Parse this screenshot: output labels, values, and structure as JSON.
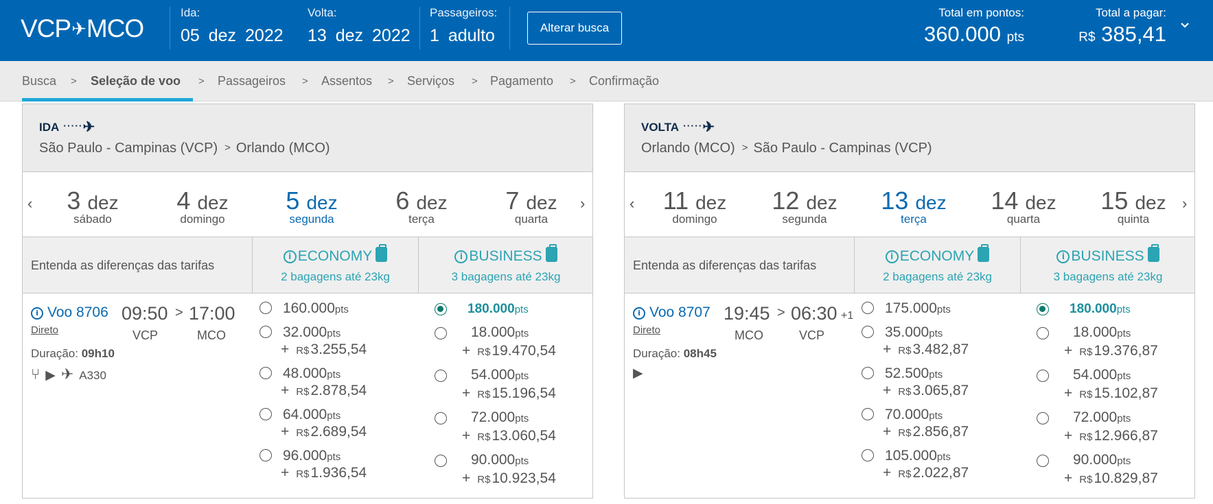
{
  "header": {
    "origin": "VCP",
    "destination": "MCO",
    "ida_label": "Ida:",
    "ida_value": "05 dez 2022",
    "volta_label": "Volta:",
    "volta_value": "13 dez 2022",
    "passageiros_label": "Passageiros:",
    "passageiros_value": "1 adulto",
    "alterar_label": "Alterar busca",
    "total_pontos_label": "Total em pontos:",
    "total_pontos_value": "360.000",
    "total_pontos_unit": "pts",
    "total_pagar_label": "Total a pagar:",
    "total_pagar_currency": "R$",
    "total_pagar_value": "385,41"
  },
  "steps": [
    "Busca",
    "Seleção de voo",
    "Passageiros",
    "Assentos",
    "Serviços",
    "Pagamento",
    "Confirmação"
  ],
  "active_step": "Seleção de voo",
  "colors": {
    "header_bg": "#0066b3",
    "accent_teal": "#2ba4b3",
    "selected_date": "#0a6ab1",
    "step_underline": "#1fa7d9"
  },
  "fare_labels": {
    "compare": "Entenda as diferenças das tarifas",
    "economy": "ECONOMY",
    "economy_bags": "2 bagagens até 23kg",
    "business": "BUSINESS",
    "business_bags": "3 bagagens até 23kg",
    "pts_unit": "pts",
    "currency": "R$",
    "plus": "+",
    "direct": "Direto",
    "duration_label": "Duração:"
  },
  "ida": {
    "direction": "IDA",
    "from": "São Paulo - Campinas (VCP)",
    "to": "Orlando (MCO)",
    "dates": [
      {
        "day": "3",
        "month": "dez",
        "weekday": "sábado"
      },
      {
        "day": "4",
        "month": "dez",
        "weekday": "domingo"
      },
      {
        "day": "5",
        "month": "dez",
        "weekday": "segunda",
        "selected": true
      },
      {
        "day": "6",
        "month": "dez",
        "weekday": "terça"
      },
      {
        "day": "7",
        "month": "dez",
        "weekday": "quarta"
      }
    ],
    "flight": {
      "number": "Voo 8706",
      "dep_time": "09:50",
      "arr_time": "17:00",
      "dep_airport": "VCP",
      "arr_airport": "MCO",
      "duration": "09h10",
      "aircraft": "A330"
    },
    "economy": [
      {
        "pts": "160.000",
        "money": ""
      },
      {
        "pts": "32.000",
        "money": "3.255,54"
      },
      {
        "pts": "48.000",
        "money": "2.878,54"
      },
      {
        "pts": "64.000",
        "money": "2.689,54"
      },
      {
        "pts": "96.000",
        "money": "1.936,54"
      }
    ],
    "business": [
      {
        "pts": "180.000",
        "money": "",
        "selected": true
      },
      {
        "pts": "18.000",
        "money": "19.470,54"
      },
      {
        "pts": "54.000",
        "money": "15.196,54"
      },
      {
        "pts": "72.000",
        "money": "13.060,54"
      },
      {
        "pts": "90.000",
        "money": "10.923,54"
      }
    ]
  },
  "volta": {
    "direction": "VOLTA",
    "from": "Orlando (MCO)",
    "to": "São Paulo - Campinas (VCP)",
    "dates": [
      {
        "day": "11",
        "month": "dez",
        "weekday": "domingo"
      },
      {
        "day": "12",
        "month": "dez",
        "weekday": "segunda"
      },
      {
        "day": "13",
        "month": "dez",
        "weekday": "terça",
        "selected": true
      },
      {
        "day": "14",
        "month": "dez",
        "weekday": "quarta"
      },
      {
        "day": "15",
        "month": "dez",
        "weekday": "quinta"
      }
    ],
    "flight": {
      "number": "Voo 8707",
      "dep_time": "19:45",
      "arr_time": "06:30",
      "plus_day": "+1",
      "dep_airport": "MCO",
      "arr_airport": "VCP",
      "duration": "08h45"
    },
    "economy": [
      {
        "pts": "175.000",
        "money": ""
      },
      {
        "pts": "35.000",
        "money": "3.482,87"
      },
      {
        "pts": "52.500",
        "money": "3.065,87"
      },
      {
        "pts": "70.000",
        "money": "2.856,87"
      },
      {
        "pts": "105.000",
        "money": "2.022,87"
      }
    ],
    "business": [
      {
        "pts": "180.000",
        "money": "",
        "selected": true
      },
      {
        "pts": "18.000",
        "money": "19.376,87"
      },
      {
        "pts": "54.000",
        "money": "15.102,87"
      },
      {
        "pts": "72.000",
        "money": "12.966,87"
      },
      {
        "pts": "90.000",
        "money": "10.829,87"
      }
    ]
  }
}
